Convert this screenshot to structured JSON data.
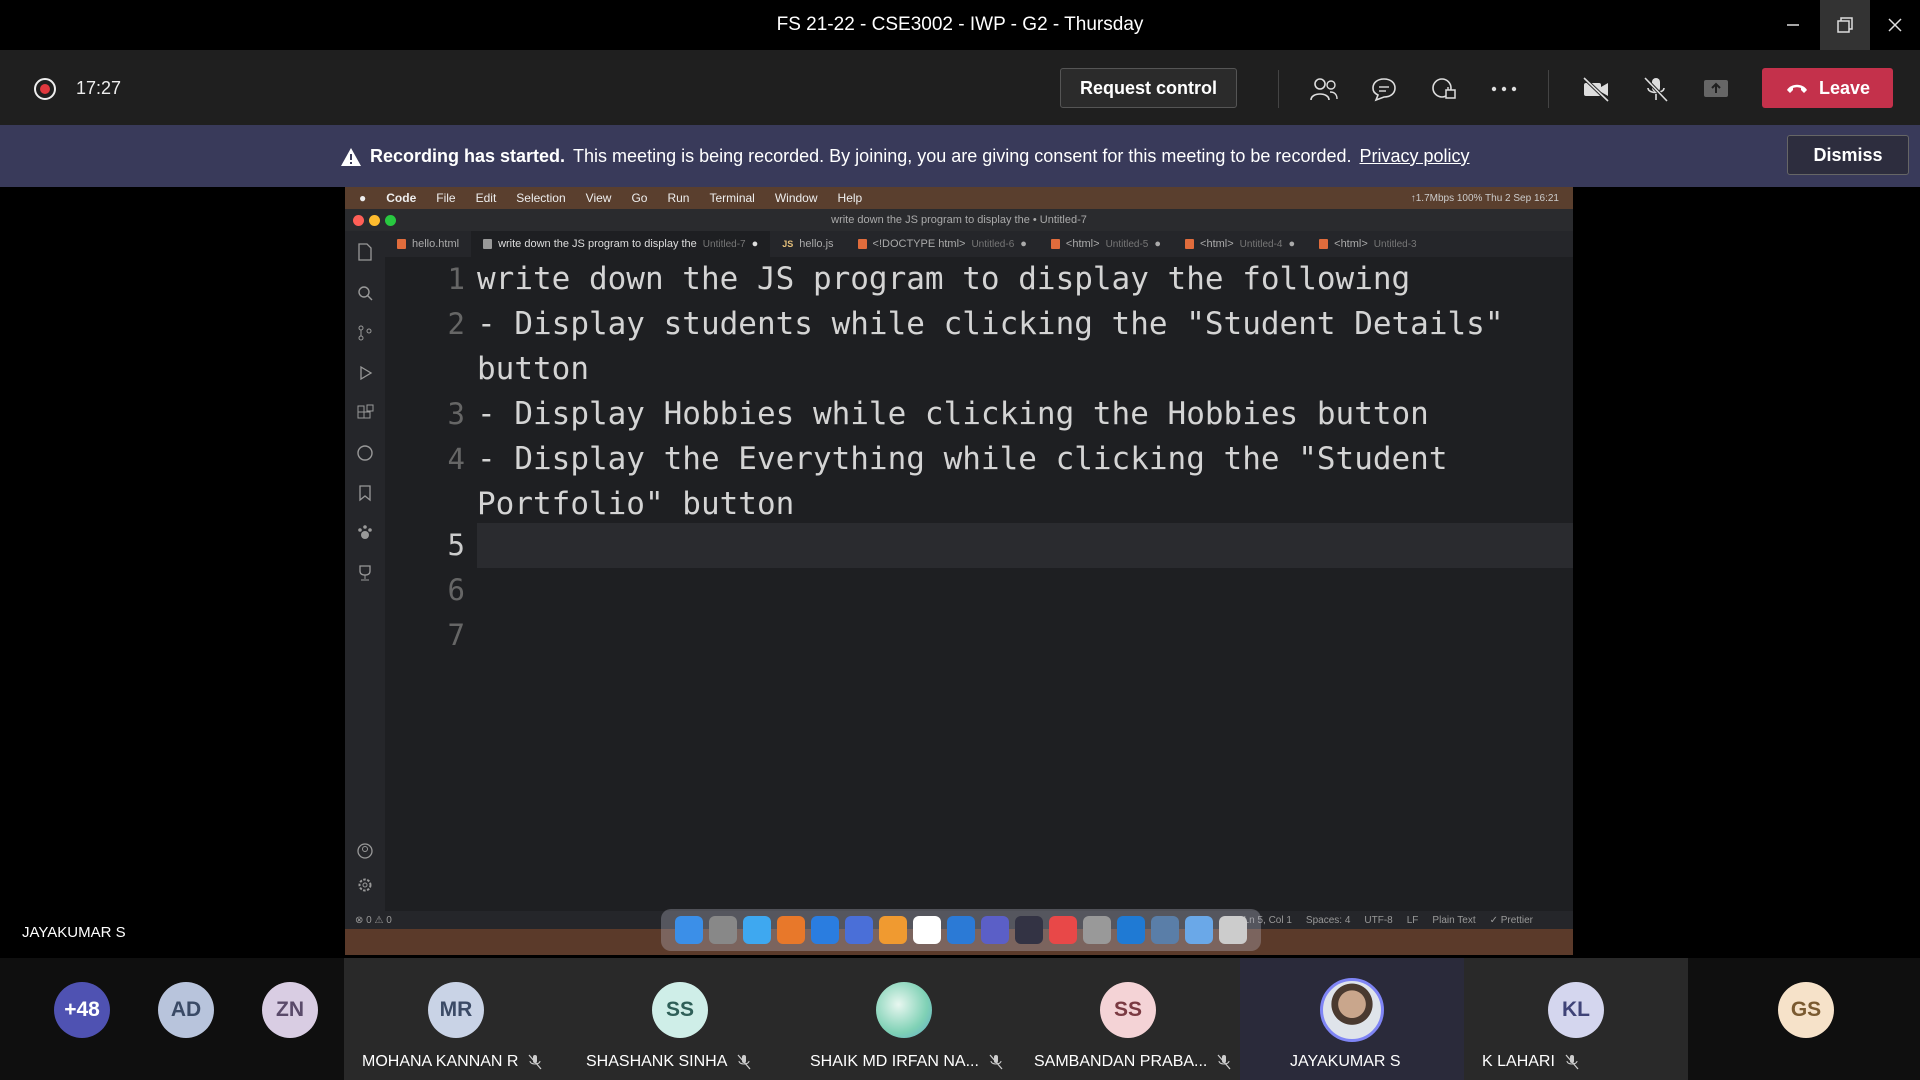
{
  "window": {
    "title": "FS 21-22 - CSE3002 - IWP - G2 - Thursday",
    "minimize_icon": "minimize-icon",
    "restore_icon": "restore-icon",
    "close_icon": "close-icon"
  },
  "meeting_bar": {
    "timer": "17:27",
    "request_control_label": "Request control",
    "leave_label": "Leave",
    "icons": [
      "people-icon",
      "chat-icon",
      "reactions-icon",
      "more-icon",
      "camera-off-icon",
      "mic-off-icon",
      "share-icon"
    ]
  },
  "banner": {
    "title": "Recording has started.",
    "message": "This meeting is being recorded. By joining, you are giving consent for this meeting to be recorded.",
    "link": "Privacy policy",
    "dismiss_label": "Dismiss"
  },
  "presenter_name": "JAYAKUMAR S",
  "shared_screen": {
    "mac_menu": [
      "Code",
      "File",
      "Edit",
      "Selection",
      "View",
      "Go",
      "Run",
      "Terminal",
      "Window",
      "Help"
    ],
    "mac_status": "↑1.7Mbps  100%  Thu 2 Sep  16:21",
    "window_title": "write down the JS program to display the • Untitled-7",
    "tabs": [
      {
        "label": "hello.html",
        "sub": ""
      },
      {
        "label": "write down the JS program to display the",
        "sub": "Untitled-7"
      },
      {
        "label": "hello.js",
        "sub": ""
      },
      {
        "label": "<!DOCTYPE html>",
        "sub": "Untitled-6"
      },
      {
        "label": "<html>",
        "sub": "Untitled-5"
      },
      {
        "label": "<html>",
        "sub": "Untitled-4"
      },
      {
        "label": "<html>",
        "sub": "Untitled-3"
      }
    ],
    "code_lines": [
      {
        "num": "1",
        "text": "write down the JS program to display the following"
      },
      {
        "num": "2",
        "text": "- Display students while clicking the \"Student Details\""
      },
      {
        "num": "",
        "text": "button"
      },
      {
        "num": "3",
        "text": "- Display Hobbies while clicking the Hobbies button"
      },
      {
        "num": "4",
        "text": "- Display the Everything while clicking the \"Student"
      },
      {
        "num": "",
        "text": "Portfolio\" button"
      },
      {
        "num": "5",
        "text": ""
      },
      {
        "num": "6",
        "text": ""
      },
      {
        "num": "7",
        "text": ""
      }
    ],
    "status_left": "⊗ 0 ⚠ 0",
    "status_right": [
      "Ln 5, Col 1",
      "Spaces: 4",
      "UTF-8",
      "LF",
      "Plain Text",
      "✓ Prettier"
    ]
  },
  "participants": [
    {
      "initials": "+48",
      "name": "",
      "color": "#4f52b2",
      "text_color": "#ffffff"
    },
    {
      "initials": "AD",
      "name": "",
      "color": "#b8c4dc",
      "text_color": "#3a4a66"
    },
    {
      "initials": "ZN",
      "name": "",
      "color": "#d9cde3",
      "text_color": "#5a4a6a"
    },
    {
      "initials": "MR",
      "name": "MOHANA KANNAN R",
      "color": "#c9d3e6",
      "text_color": "#3b4a66"
    },
    {
      "initials": "SS",
      "name": "SHASHANK SINHA",
      "color": "#cfeee8",
      "text_color": "#2f5f58"
    },
    {
      "initials": "",
      "name": "SHAIK MD IRFAN NA...",
      "color": "#7fd1b5",
      "text_color": "#ffffff"
    },
    {
      "initials": "SS",
      "name": "SAMBANDAN PRABA...",
      "color": "#f4d3d6",
      "text_color": "#7a3a42"
    },
    {
      "initials": "",
      "name": "JAYAKUMAR S",
      "color": "#8b6a5a",
      "text_color": "#ffffff"
    },
    {
      "initials": "KL",
      "name": "K LAHARI",
      "color": "#d4d6ee",
      "text_color": "#3f4377"
    },
    {
      "initials": "GS",
      "name": "",
      "color": "#f6e2c9",
      "text_color": "#7a5a30"
    }
  ]
}
